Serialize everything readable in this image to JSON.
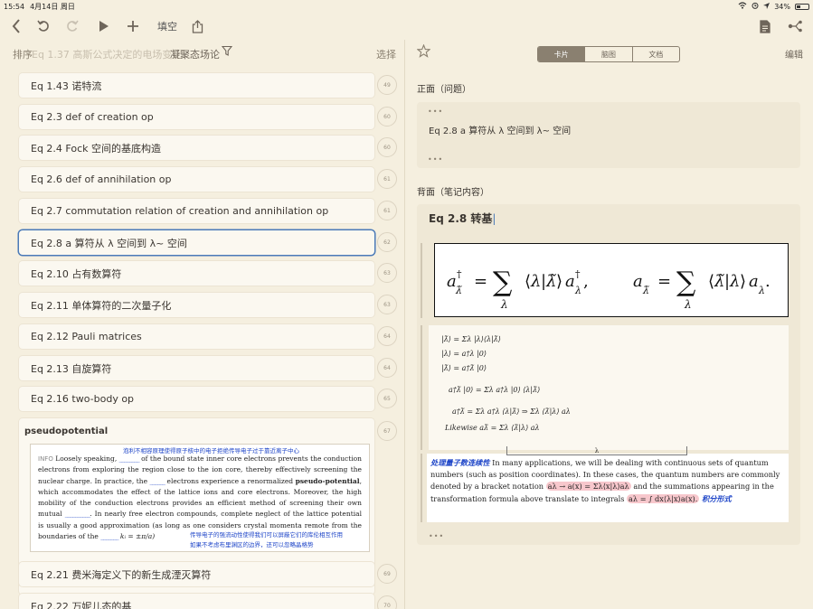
{
  "status": {
    "time": "15:54",
    "date": "4月14日 周日",
    "battery": "34%",
    "battery_level": 0.34
  },
  "toolbar": {
    "fill_label": "填空"
  },
  "left": {
    "sort_label": "排序",
    "breadcrumb": "Eq 1.37 高斯公式决定的电场变化...",
    "title": "凝聚态场论",
    "select_label": "选择",
    "items": [
      {
        "label": "Eq 1.43 诺特流",
        "badge": "49"
      },
      {
        "label": "Eq 2.3 def of creation op",
        "badge": "60"
      },
      {
        "label": "Eq 2.4 Fock 空间的基底构造",
        "badge": "60"
      },
      {
        "label": "Eq 2.6 def of annihilation op",
        "badge": "61"
      },
      {
        "label": "Eq 2.7 commutation relation of creation and annihilation op",
        "badge": "61"
      },
      {
        "label": "Eq 2.8 a 算符从 λ 空间到 λ~ 空间",
        "badge": "62"
      },
      {
        "label": "Eq 2.10 占有数算符",
        "badge": "63"
      },
      {
        "label": "Eq 2.11 单体算符的二次量子化",
        "badge": "63"
      },
      {
        "label": "Eq 2.12 Pauli matrices",
        "badge": "64"
      },
      {
        "label": "Eq 2.13 自旋算符",
        "badge": "64"
      },
      {
        "label": "Eq 2.16 two-body op",
        "badge": "65"
      }
    ],
    "pseudo": {
      "title": "pseudopotential",
      "badge": "67",
      "info": "INFO",
      "text1": "Loosely speaking,",
      "text2": "of the bound state inner core electrons prevents the conduction electrons from exploring the region close to the ion core, thereby effectively screening the nuclear charge. In practice, the",
      "text3": "electrons experience a renormalized",
      "bold1": "pseudo-potential",
      "text4": ", which accommodates the effect of the lattice ions and core electrons. Moreover, the high mobility of the conduction electrons provides an efficient method of screening their own mutual",
      "text5": ". In nearly free electron compounds, complete neglect of the lattice potential is usually a good approximation (as long as one considers crystal momenta remote from the boundaries of the",
      "math1": "kᵢ = ±π/a)",
      "note1": "泡利不相容原理使得原子核中的电子拒绝传导电子过于靠近离子中心",
      "note2": "传导电子的强流动性使得我们可以屏蔽它们的库伦相互作用",
      "note3": "如果不考虑布里渊区的边界，还可以忽略晶格势"
    },
    "more_items": [
      {
        "label": "Eq 2.21 费米海定义下的新生成湮灭算符",
        "badge": "69"
      },
      {
        "label": "Eq 2.22 万妮儿态的基",
        "badge": "70"
      }
    ]
  },
  "right": {
    "tabs": [
      {
        "label": "卡片",
        "active": true
      },
      {
        "label": "脑图",
        "active": false
      },
      {
        "label": "文档",
        "active": false
      }
    ],
    "edit_label": "编辑",
    "front_label": "正面（问题）",
    "front_text": "Eq 2.8 a 算符从 λ 空间到 λ~ 空间",
    "back_label": "背面（笔记内容）",
    "back_title": "Eq 2.8 转基",
    "hand_lines": [
      "|λ̃⟩ = Σλ |λ⟩⟨λ|λ̃⟩",
      "|λ⟩ = a†λ |0⟩",
      "|λ̃⟩ = a†λ̃ |0⟩",
      "a†λ̃ |0⟩ = Σλ a†λ |0⟩ ⟨λ|λ̃⟩",
      "a†λ̃ = Σλ a†λ ⟨λ|λ̃⟩  ⇒  Σλ ⟨λ̃|λ⟩ aλ",
      "Likewise   aλ̃ = Σλ ⟨λ̃|λ⟩ aλ"
    ],
    "para_note": "处理量子数连续性",
    "para_text1": "In many applications, we will be dealing with continuous sets of quantum numbers (such as position coordinates). In these cases, the quantum numbers are commonly denoted by a bracket notation",
    "para_hl1": "aλ → a(x) = Σλ⟨x|λ⟩aλ",
    "para_text2": "and the summations appearing in the transformation formula above translate to integrals",
    "para_hl2": "aλ = ∫ dx⟨λ|x⟩a(x).",
    "para_note2": "积分形式",
    "lambda": "λ"
  },
  "colors": {
    "accent": "#4a7ab8",
    "note_blue": "#1f46c8",
    "highlight": "#f7c7cc"
  }
}
